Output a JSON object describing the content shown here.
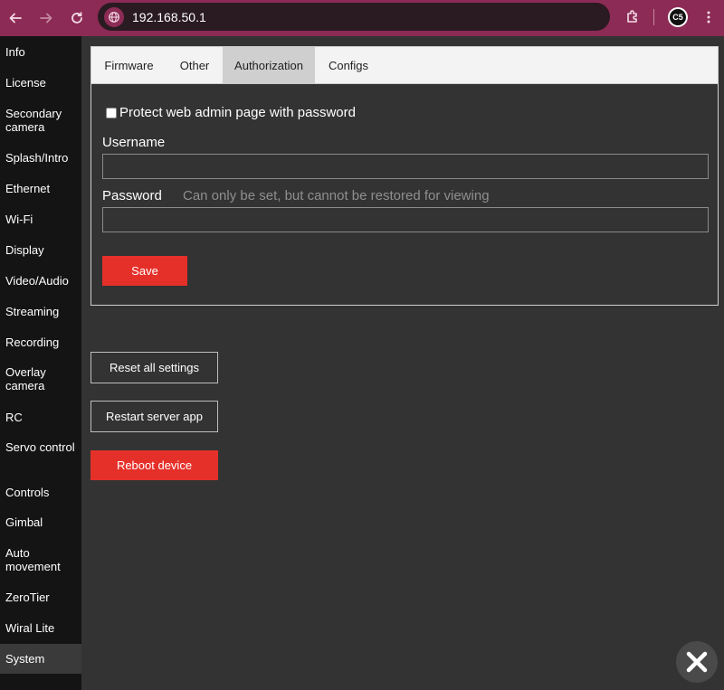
{
  "browser": {
    "url": "192.168.50.1",
    "profile_initials": "C5"
  },
  "sidebar": {
    "items": [
      {
        "label": "Info"
      },
      {
        "label": "License"
      },
      {
        "label": "Secondary camera"
      },
      {
        "label": "Splash/Intro"
      },
      {
        "label": "Ethernet"
      },
      {
        "label": "Wi-Fi"
      },
      {
        "label": "Display"
      },
      {
        "label": "Video/Audio"
      },
      {
        "label": "Streaming"
      },
      {
        "label": "Recording"
      },
      {
        "label": "Overlay camera"
      },
      {
        "label": "RC"
      },
      {
        "label": "Servo control"
      },
      {
        "label": "Controls"
      },
      {
        "label": "Gimbal"
      },
      {
        "label": "Auto movement"
      },
      {
        "label": "ZeroTier"
      },
      {
        "label": "Wiral Lite"
      },
      {
        "label": "System"
      }
    ],
    "active": "System"
  },
  "tabs": [
    {
      "label": "Firmware"
    },
    {
      "label": "Other"
    },
    {
      "label": "Authorization"
    },
    {
      "label": "Configs"
    }
  ],
  "active_tab": "Authorization",
  "auth": {
    "protect_label": "Protect web admin page with password",
    "protect_checked": false,
    "username_label": "Username",
    "username_value": "",
    "password_label": "Password",
    "password_hint": "Can only be set, but cannot be restored for viewing",
    "password_value": "",
    "save_label": "Save"
  },
  "actions": {
    "reset_label": "Reset all settings",
    "restart_label": "Restart server app",
    "reboot_label": "Reboot device"
  },
  "colors": {
    "accent_red": "#e5302a",
    "chrome_bar": "#8c2b55",
    "page_bg": "#333333",
    "sidebar_bg": "#141414"
  },
  "icons": {
    "back": "arrow-left-icon",
    "forward": "arrow-right-icon",
    "reload": "reload-icon",
    "site": "globe-icon",
    "extensions": "puzzle-icon",
    "menu": "kebab-menu-icon",
    "close": "close-icon"
  }
}
